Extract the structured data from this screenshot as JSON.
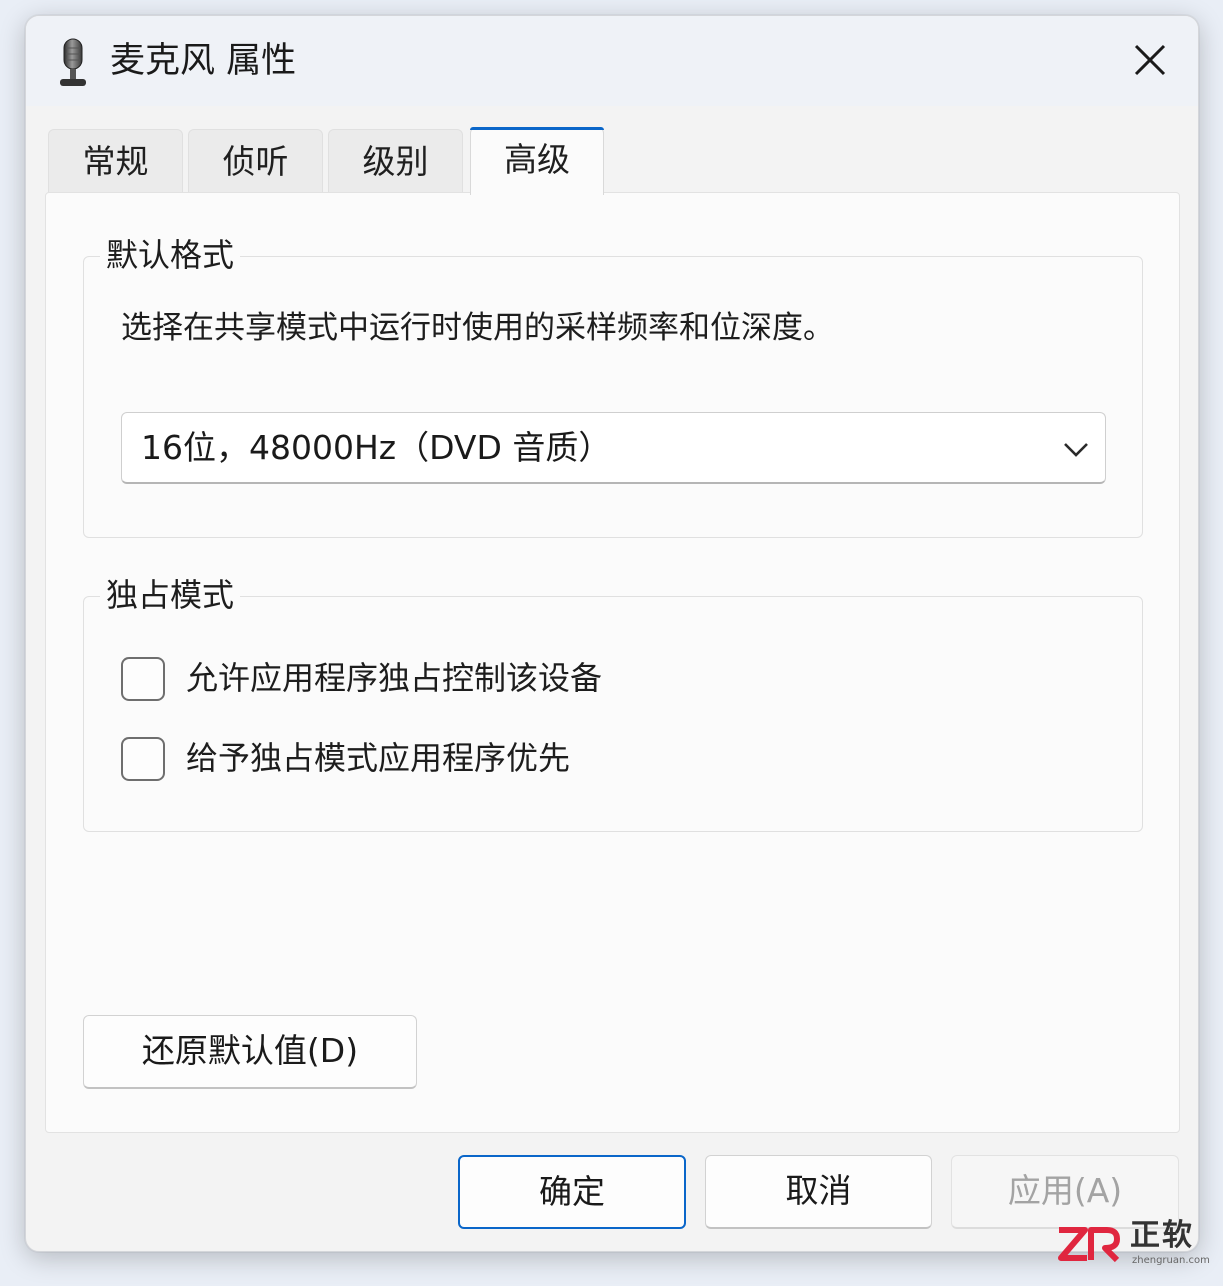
{
  "window": {
    "title": "麦克风 属性",
    "icon": "microphone-icon",
    "close_icon": "close-icon"
  },
  "tabs": [
    {
      "label": "常规",
      "active": false
    },
    {
      "label": "侦听",
      "active": false
    },
    {
      "label": "级别",
      "active": false
    },
    {
      "label": "高级",
      "active": true
    }
  ],
  "default_format": {
    "title": "默认格式",
    "description": "选择在共享模式中运行时使用的采样频率和位深度。",
    "selected_value": "16位，48000Hz（DVD 音质）",
    "dropdown_icon": "chevron-down-icon"
  },
  "exclusive_mode": {
    "title": "独占模式",
    "options": [
      {
        "label": "允许应用程序独占控制该设备",
        "checked": false
      },
      {
        "label": "给予独占模式应用程序优先",
        "checked": false
      }
    ]
  },
  "buttons": {
    "restore_defaults": "还原默认值(D)",
    "ok": "确定",
    "cancel": "取消",
    "apply": "应用(A)"
  },
  "watermark": {
    "name": "正软",
    "url": "zhengruan.com",
    "logo_text": "ZR"
  },
  "colors": {
    "accent": "#0a66c9",
    "watermark_red": "#e0263f"
  }
}
